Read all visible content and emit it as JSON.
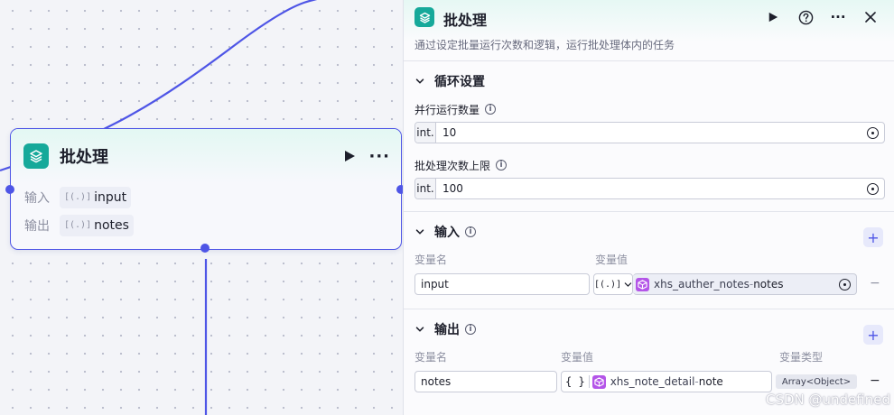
{
  "node": {
    "title": "批处理",
    "rows": [
      {
        "label": "输入",
        "bracket": "[(.)]",
        "value": "input"
      },
      {
        "label": "输出",
        "bracket": "[(.)]",
        "value": "notes"
      }
    ]
  },
  "panel": {
    "title": "批处理",
    "description": "通过设定批量运行次数和逻辑，运行批处理体内的任务",
    "loop": {
      "title": "循环设置",
      "parallel_label": "并行运行数量",
      "parallel_type": "int.",
      "parallel_value": "10",
      "max_label": "批处理次数上限",
      "max_type": "int.",
      "max_value": "100"
    },
    "input": {
      "title": "输入",
      "col_name": "变量名",
      "col_value": "变量值",
      "name": "input",
      "type_bracket": "[(.)]",
      "ref_node": "xhs_auther_notes",
      "ref_sep": " - ",
      "ref_field": "notes"
    },
    "output": {
      "title": "输出",
      "col_name": "变量名",
      "col_value": "变量值",
      "col_type": "变量类型",
      "name": "notes",
      "type_bracket": "{ }",
      "ref_node": "xhs_note_detail",
      "ref_sep": " - ",
      "ref_field": "note",
      "var_type": "Array<Object>"
    }
  },
  "watermark": "CSDN @undefined",
  "colors": {
    "accent": "#4e55e6",
    "node_logo": "#16a99a",
    "ref_icon": "#b455e8"
  }
}
